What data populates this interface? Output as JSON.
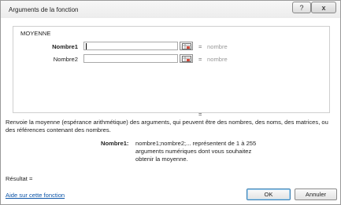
{
  "window": {
    "title": "Arguments de la fonction",
    "help_glyph": "?",
    "close_glyph": "x"
  },
  "function": {
    "name": "MOYENNE",
    "args": [
      {
        "label": "Nombre1",
        "value": "",
        "bold": true,
        "hint": "nombre"
      },
      {
        "label": "Nombre2",
        "value": "",
        "bold": false,
        "hint": "nombre"
      }
    ],
    "equals": "=",
    "result_equals": "="
  },
  "description": {
    "main": "Renvoie la moyenne (espérance arithmétique) des arguments, qui peuvent être des nombres, des noms, des matrices, ou des références contenant des nombres.",
    "arg_label": "Nombre1:",
    "arg_text": "nombre1;nombre2;... représentent de 1 à 255 arguments numériques dont vous souhaitez obtenir la moyenne."
  },
  "footer": {
    "result_label": "Résultat =",
    "help_link": "Aide sur cette fonction",
    "ok_label": "OK",
    "cancel_label": "Annuler"
  },
  "icons": {
    "ref_button": "collapse-dialog-icon"
  }
}
